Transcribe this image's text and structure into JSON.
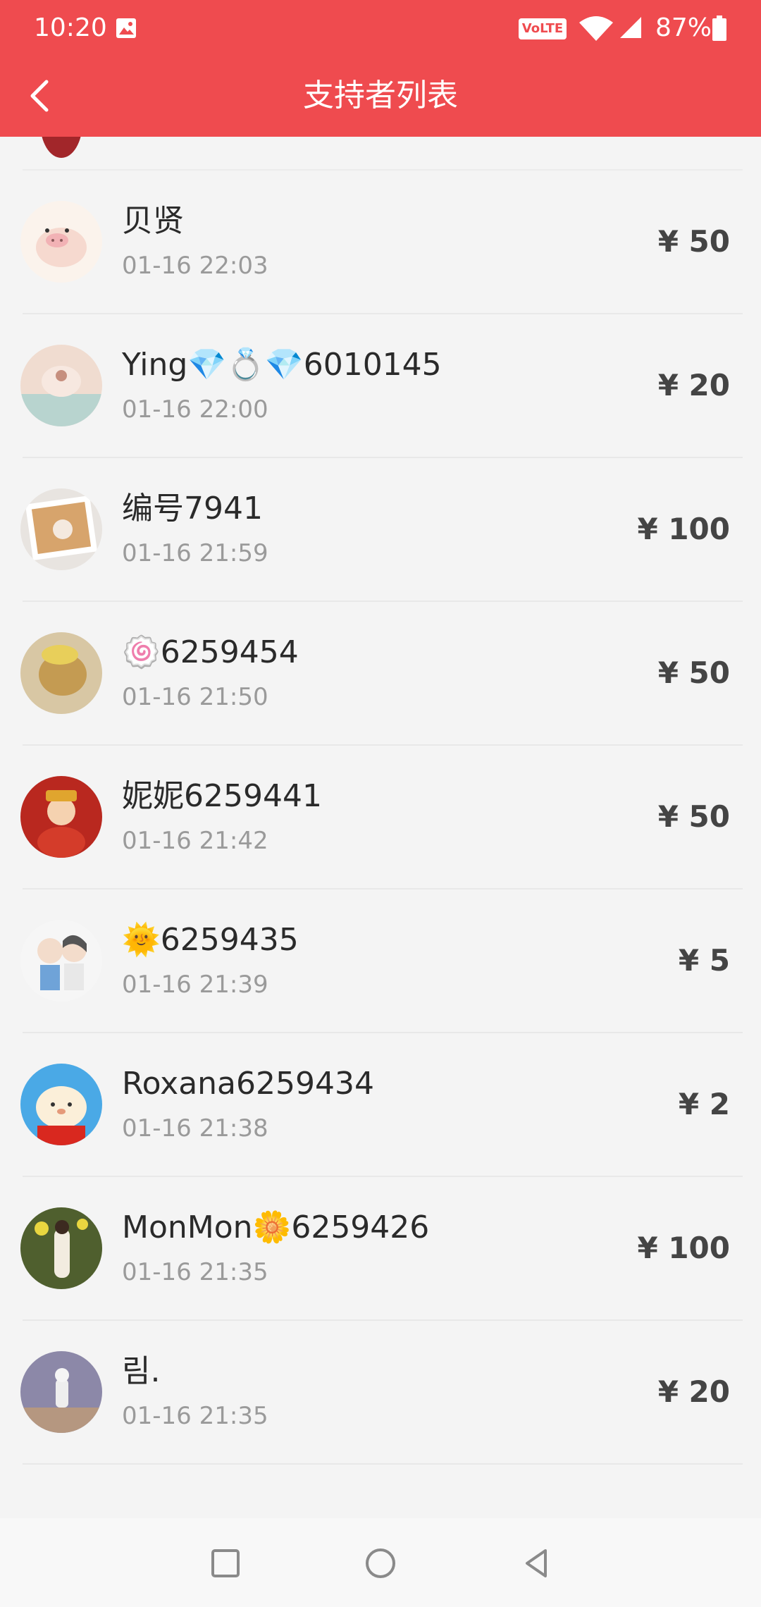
{
  "status_bar": {
    "time": "10:20",
    "volte_label": "VoLTE",
    "battery_text": "87%"
  },
  "header": {
    "title": "支持者列表",
    "back_icon": "chevron-left-icon",
    "background_color": "#ef4b4f"
  },
  "supporters": [
    {
      "name": "贝贤",
      "time": "01-16 22:03",
      "amount": "¥ 50",
      "avatar_color": "#f6e6da"
    },
    {
      "name": "Ying💎💍💎6010145",
      "time": "01-16 22:00",
      "amount": "¥ 20",
      "avatar_color": "#e9cfc4"
    },
    {
      "name": "编号7941",
      "time": "01-16 21:59",
      "amount": "¥ 100",
      "avatar_color": "#d9b48c"
    },
    {
      "name": "🍥6259454",
      "time": "01-16 21:50",
      "amount": "¥ 50",
      "avatar_color": "#c9a66a"
    },
    {
      "name": "妮妮6259441",
      "time": "01-16 21:42",
      "amount": "¥ 50",
      "avatar_color": "#b9281f"
    },
    {
      "name": "🌞6259435",
      "time": "01-16 21:39",
      "amount": "¥ 5",
      "avatar_color": "#f3f3f3"
    },
    {
      "name": "Roxana6259434",
      "time": "01-16 21:38",
      "amount": "¥ 2",
      "avatar_color": "#4aa9e6"
    },
    {
      "name": "MonMon🌼6259426",
      "time": "01-16 21:35",
      "amount": "¥ 100",
      "avatar_color": "#5d6b3a"
    },
    {
      "name": "림.",
      "time": "01-16 21:35",
      "amount": "¥ 20",
      "avatar_color": "#8a86a6"
    }
  ],
  "nav_bar": {
    "recents_icon": "square-icon",
    "home_icon": "circle-icon",
    "back_icon": "triangle-back-icon"
  }
}
